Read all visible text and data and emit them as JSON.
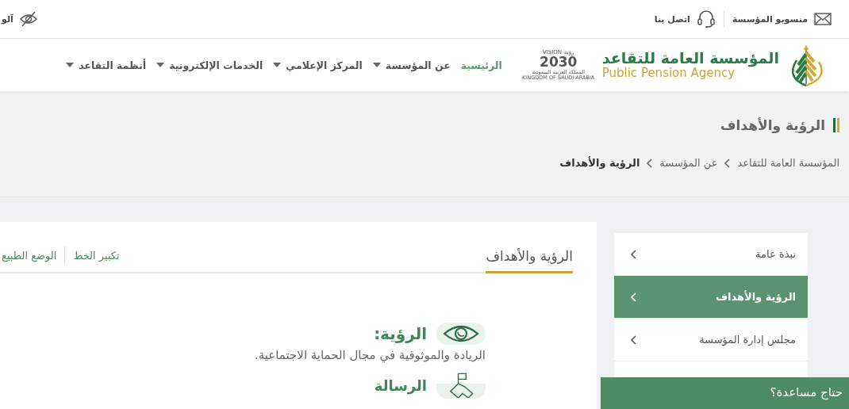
{
  "top_bar": {
    "links": [
      {
        "label": "منسوبو المؤسسة"
      },
      {
        "label": "اتصل بنا"
      }
    ],
    "display_mode": {
      "label": "آلو"
    }
  },
  "header": {
    "logo": {
      "name_ar": "المؤسسة العامة للتقاعد",
      "name_en": "Public Pension Agency"
    },
    "vision_logo": {
      "word_ar": "رؤية",
      "word_en": "VISION",
      "year": "2030",
      "country_ar": "المملكة العربية السعودية",
      "country_en": "KINGDOM OF SAUDI ARABIA"
    },
    "nav": [
      {
        "label": "الرئيسية",
        "selected": true,
        "dropdown": false
      },
      {
        "label": "عن المؤسسة",
        "selected": false,
        "dropdown": true
      },
      {
        "label": "المركز الإعلامي",
        "selected": false,
        "dropdown": true
      },
      {
        "label": "الخدمات الإلكترونية",
        "selected": false,
        "dropdown": true
      },
      {
        "label": "أنظمة التقاعد",
        "selected": false,
        "dropdown": true
      }
    ]
  },
  "page_title": "الرؤية والأهداف",
  "breadcrumb": [
    {
      "label": "المؤسسة العامة للتقاعد",
      "current": false
    },
    {
      "label": "عن المؤسسة",
      "current": false
    },
    {
      "label": "الرؤية والأهداف",
      "current": true
    }
  ],
  "sidebar": {
    "items": [
      {
        "label": "نبذة عامة",
        "selected": false
      },
      {
        "label": "الرؤية والأهداف",
        "selected": true
      },
      {
        "label": "مجلس إدارة المؤسسة",
        "selected": false
      }
    ]
  },
  "content": {
    "tabs": [
      {
        "label": "الرؤية والأهداف",
        "selected": true
      }
    ],
    "tools": [
      "تكبير الخط",
      "الوضع الطبيع"
    ],
    "sections": [
      {
        "title": "الرؤية:",
        "text": "الريادة والموثوقية في مجال الحماية الاجتماعية."
      },
      {
        "title": "الرسالة"
      }
    ]
  },
  "help_button": {
    "label": "حتاج مساعدة؟"
  }
}
